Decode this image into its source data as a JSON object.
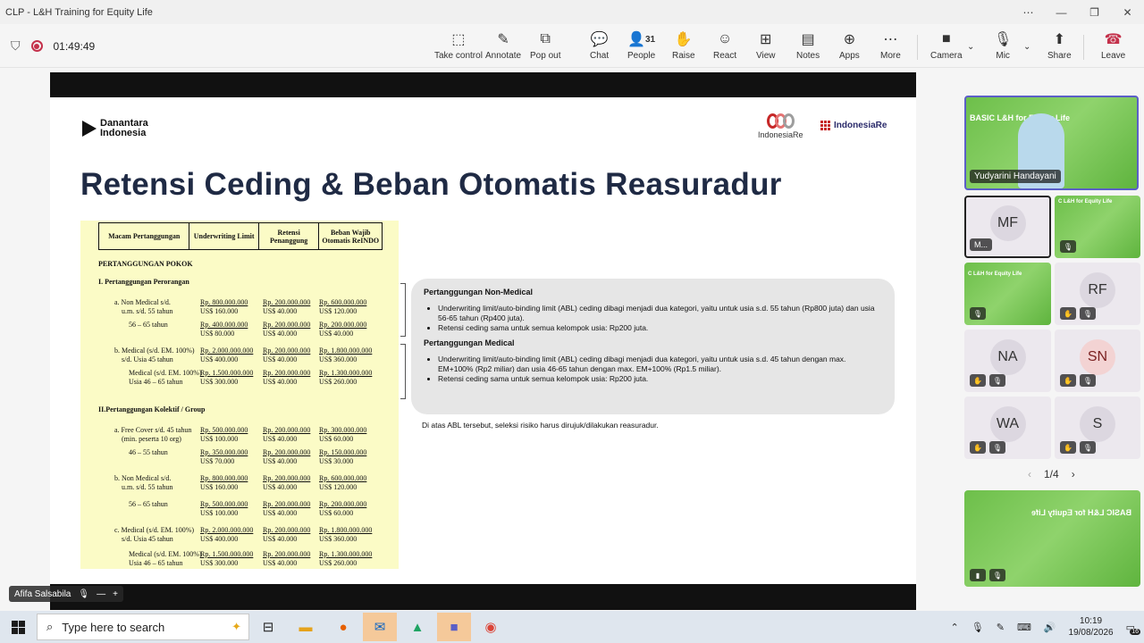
{
  "window": {
    "title": "CLP - L&H Training for Equity Life"
  },
  "meeting": {
    "timer": "01:49:49",
    "people_count": "31"
  },
  "toolbar": {
    "take_control": "Take control",
    "annotate": "Annotate",
    "pop_out": "Pop out",
    "chat": "Chat",
    "people": "People",
    "raise": "Raise",
    "react": "React",
    "view": "View",
    "notes": "Notes",
    "apps": "Apps",
    "more": "More",
    "camera": "Camera",
    "mic": "Mic",
    "share": "Share",
    "leave": "Leave"
  },
  "slide": {
    "logo_danantara_1": "Danantara",
    "logo_danantara_2": "Indonesia",
    "logo_indonesiare": "IndonesiaRe",
    "logo_institute": "IndonesiaRe",
    "title": "Retensi Ceding & Beban Otomatis Reasuradur",
    "table": {
      "headers": [
        "Macam Pertanggungan",
        "Underwriting Limit",
        "Retensi Penanggung",
        "Beban Wajib Otomatis ReINDO"
      ],
      "section_main": "PERTANGGUNGAN POKOK",
      "sec1": "I.  Pertanggungan Perorangan",
      "sec2": "II.Pertanggungan Kolektif / Group",
      "rows": [
        {
          "label": "a. Non Medical s/d.",
          "rp": [
            "Rp.  800.000.000",
            "Rp. 200.000.000",
            "Rp.   600.000.000"
          ]
        },
        {
          "label": "u.m. s/d. 55 tahun",
          "us": [
            "US$        160.000",
            "US$        40.000",
            "US$        120.000"
          ]
        },
        {
          "label": "56 – 65 tahun",
          "rp": [
            "Rp.  400.000.000",
            "Rp. 200.000.000",
            "Rp.   200.000.000"
          ]
        },
        {
          "label": "",
          "us": [
            "US$          80.000",
            "US$        40.000",
            "US$          40.000"
          ]
        },
        {
          "label": "b. Medical (s/d. EM. 100%)",
          "rp": [
            "Rp. 2.000.000.000",
            "Rp. 200.000.000",
            "Rp. 1.800.000.000"
          ]
        },
        {
          "label": "s/d. Usia 45 tahun",
          "us": [
            "US$        400.000",
            "US$        40.000",
            "US$        360.000"
          ]
        },
        {
          "label": "Medical (s/d. EM. 100%)",
          "rp": [
            "Rp. 1.500.000.000",
            "Rp. 200.000.000",
            "Rp. 1.300.000.000"
          ]
        },
        {
          "label": "Usia 46 – 65 tahun",
          "us": [
            "US$        300.000",
            "US$        40.000",
            "US$        260.000"
          ]
        },
        {
          "label": "a. Free Cover s/d. 45 tahun",
          "rp": [
            "Rp.   500.000.000",
            "Rp. 200.000.000",
            "Rp.   300.000.000"
          ]
        },
        {
          "label": "(min. peserta 10 org)",
          "us": [
            "US$        100.000",
            "US$        40.000",
            "US$          60.000"
          ]
        },
        {
          "label": "46 – 55 tahun",
          "rp": [
            "Rp.   350.000.000",
            "Rp. 200.000.000",
            "Rp.   150.000.000"
          ]
        },
        {
          "label": "",
          "us": [
            "US$          70.000",
            "US$        40.000",
            "US$          30.000"
          ]
        },
        {
          "label": "b. Non Medical s/d.",
          "rp": [
            "Rp.   800.000.000",
            "Rp. 200.000.000",
            "Rp.   600.000.000"
          ]
        },
        {
          "label": "u.m. s/d. 55 tahun",
          "us": [
            "US$        160.000",
            "US$        40.000",
            "US$        120.000"
          ]
        },
        {
          "label": "56 – 65 tahun",
          "rp": [
            "Rp.   500.000.000",
            "Rp. 200.000.000",
            "Rp.   200.000.000"
          ]
        },
        {
          "label": "",
          "us": [
            "US$        100.000",
            "US$        40.000",
            "US$          60.000"
          ]
        },
        {
          "label": "c. Medical (s/d. EM. 100%)",
          "rp": [
            "Rp. 2.000.000.000",
            "Rp. 200.000.000",
            "Rp. 1.800.000.000"
          ]
        },
        {
          "label": "s/d. Usia 45 tahun",
          "us": [
            "US$        400.000",
            "US$        40.000",
            "US$        360.000"
          ]
        },
        {
          "label": "Medical (s/d. EM. 100%)",
          "rp": [
            "Rp. 1.500.000.000",
            "Rp. 200.000.000",
            "Rp. 1.300.000.000"
          ]
        },
        {
          "label": "Usia 46 – 65 tahun",
          "us": [
            "US$        300.000",
            "US$        40.000",
            "US$        260.000"
          ]
        }
      ]
    },
    "panel": {
      "h_nonmed": "Pertanggungan Non-Medical",
      "nonmed_1": "Underwriting limit/auto-binding limit (ABL) ceding dibagi menjadi dua kategori, yaitu untuk usia s.d. 55 tahun (Rp800 juta) dan usia 56-65 tahun (Rp400 juta).",
      "nonmed_2": "Retensi ceding sama untuk semua kelompok usia: Rp200 juta.",
      "h_med": "Pertanggungan Medical",
      "med_1": "Underwriting limit/auto-binding limit (ABL) ceding dibagi menjadi dua kategori, yaitu untuk usia s.d. 45 tahun dengan max. EM+100% (Rp2 miliar) dan usia 46-65 tahun dengan max. EM+100% (Rp1.5 miliar).",
      "med_2": "Retensi ceding sama untuk semua kelompok usia: Rp200 juta."
    },
    "note": "Di atas ABL tersebut, seleksi risiko harus dirujuk/dilakukan reasuradur."
  },
  "presenter_label": "Afifa Salsabila",
  "roster": {
    "speaker_name": "Yudyarini Handayani",
    "speaker_banner": "BASIC L&H for Equity Life",
    "tiles": [
      {
        "ini": "MF",
        "name": "M..."
      },
      {
        "ini": "",
        "banner": "C L&H for Equity Life"
      },
      {
        "ini": "",
        "banner": "C L&H for Equity Life"
      },
      {
        "ini": "RF"
      },
      {
        "ini": "NA"
      },
      {
        "ini": "SN"
      },
      {
        "ini": "WA"
      },
      {
        "ini": "S"
      }
    ],
    "pager": "1/4",
    "shared_banner": "BASIC L&H for Equity Life"
  },
  "taskbar": {
    "search_placeholder": "Type here to search",
    "time": "10:19",
    "date": "19/08/2026",
    "notif": "16"
  }
}
